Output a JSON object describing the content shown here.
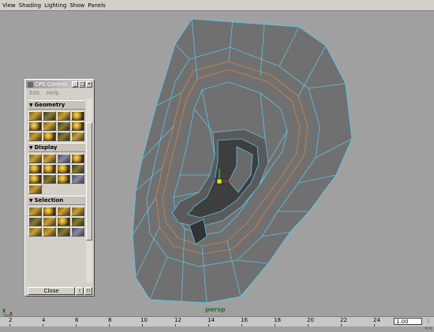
{
  "menubar": {
    "items": [
      "View",
      "Shading",
      "Lighting",
      "Show",
      "Panels"
    ]
  },
  "viewport": {
    "camera_label": "persp",
    "axis_labels": [
      "y",
      "x"
    ],
    "mesh_fill": "#707070",
    "edge_color": "#5fc3e6",
    "loop_color": "#e0803a"
  },
  "cps_window": {
    "title": "CPS Control",
    "menu": [
      "Edit",
      "Help"
    ],
    "sections": [
      {
        "label": "Geometry",
        "icons": [
          "gem",
          "ring",
          "box",
          "sphere",
          "sphere",
          "box",
          "red",
          "sphere",
          "gem",
          "sphere",
          "box",
          "box"
        ]
      },
      {
        "label": "Display",
        "icons": [
          "gem",
          "gem",
          "grid",
          "sphere",
          "sphere",
          "sphere",
          "sphere",
          "box",
          "sphere",
          "box",
          "sphere",
          "box",
          "gem"
        ]
      },
      {
        "label": "Selection",
        "icons": [
          "gem",
          "sphere",
          "gem",
          "gem",
          "gem",
          "box",
          "sphere",
          "box",
          "gem",
          "gem",
          "box",
          "box"
        ]
      }
    ],
    "close_label": "Close",
    "small_buttons": [
      "!",
      "!!"
    ]
  },
  "timeline": {
    "ticks": [
      "2",
      "4",
      "6",
      "8",
      "10",
      "12",
      "14",
      "16",
      "18",
      "20",
      "22",
      "24"
    ],
    "current_frame": "1.00",
    "frame_button": "|<<"
  }
}
